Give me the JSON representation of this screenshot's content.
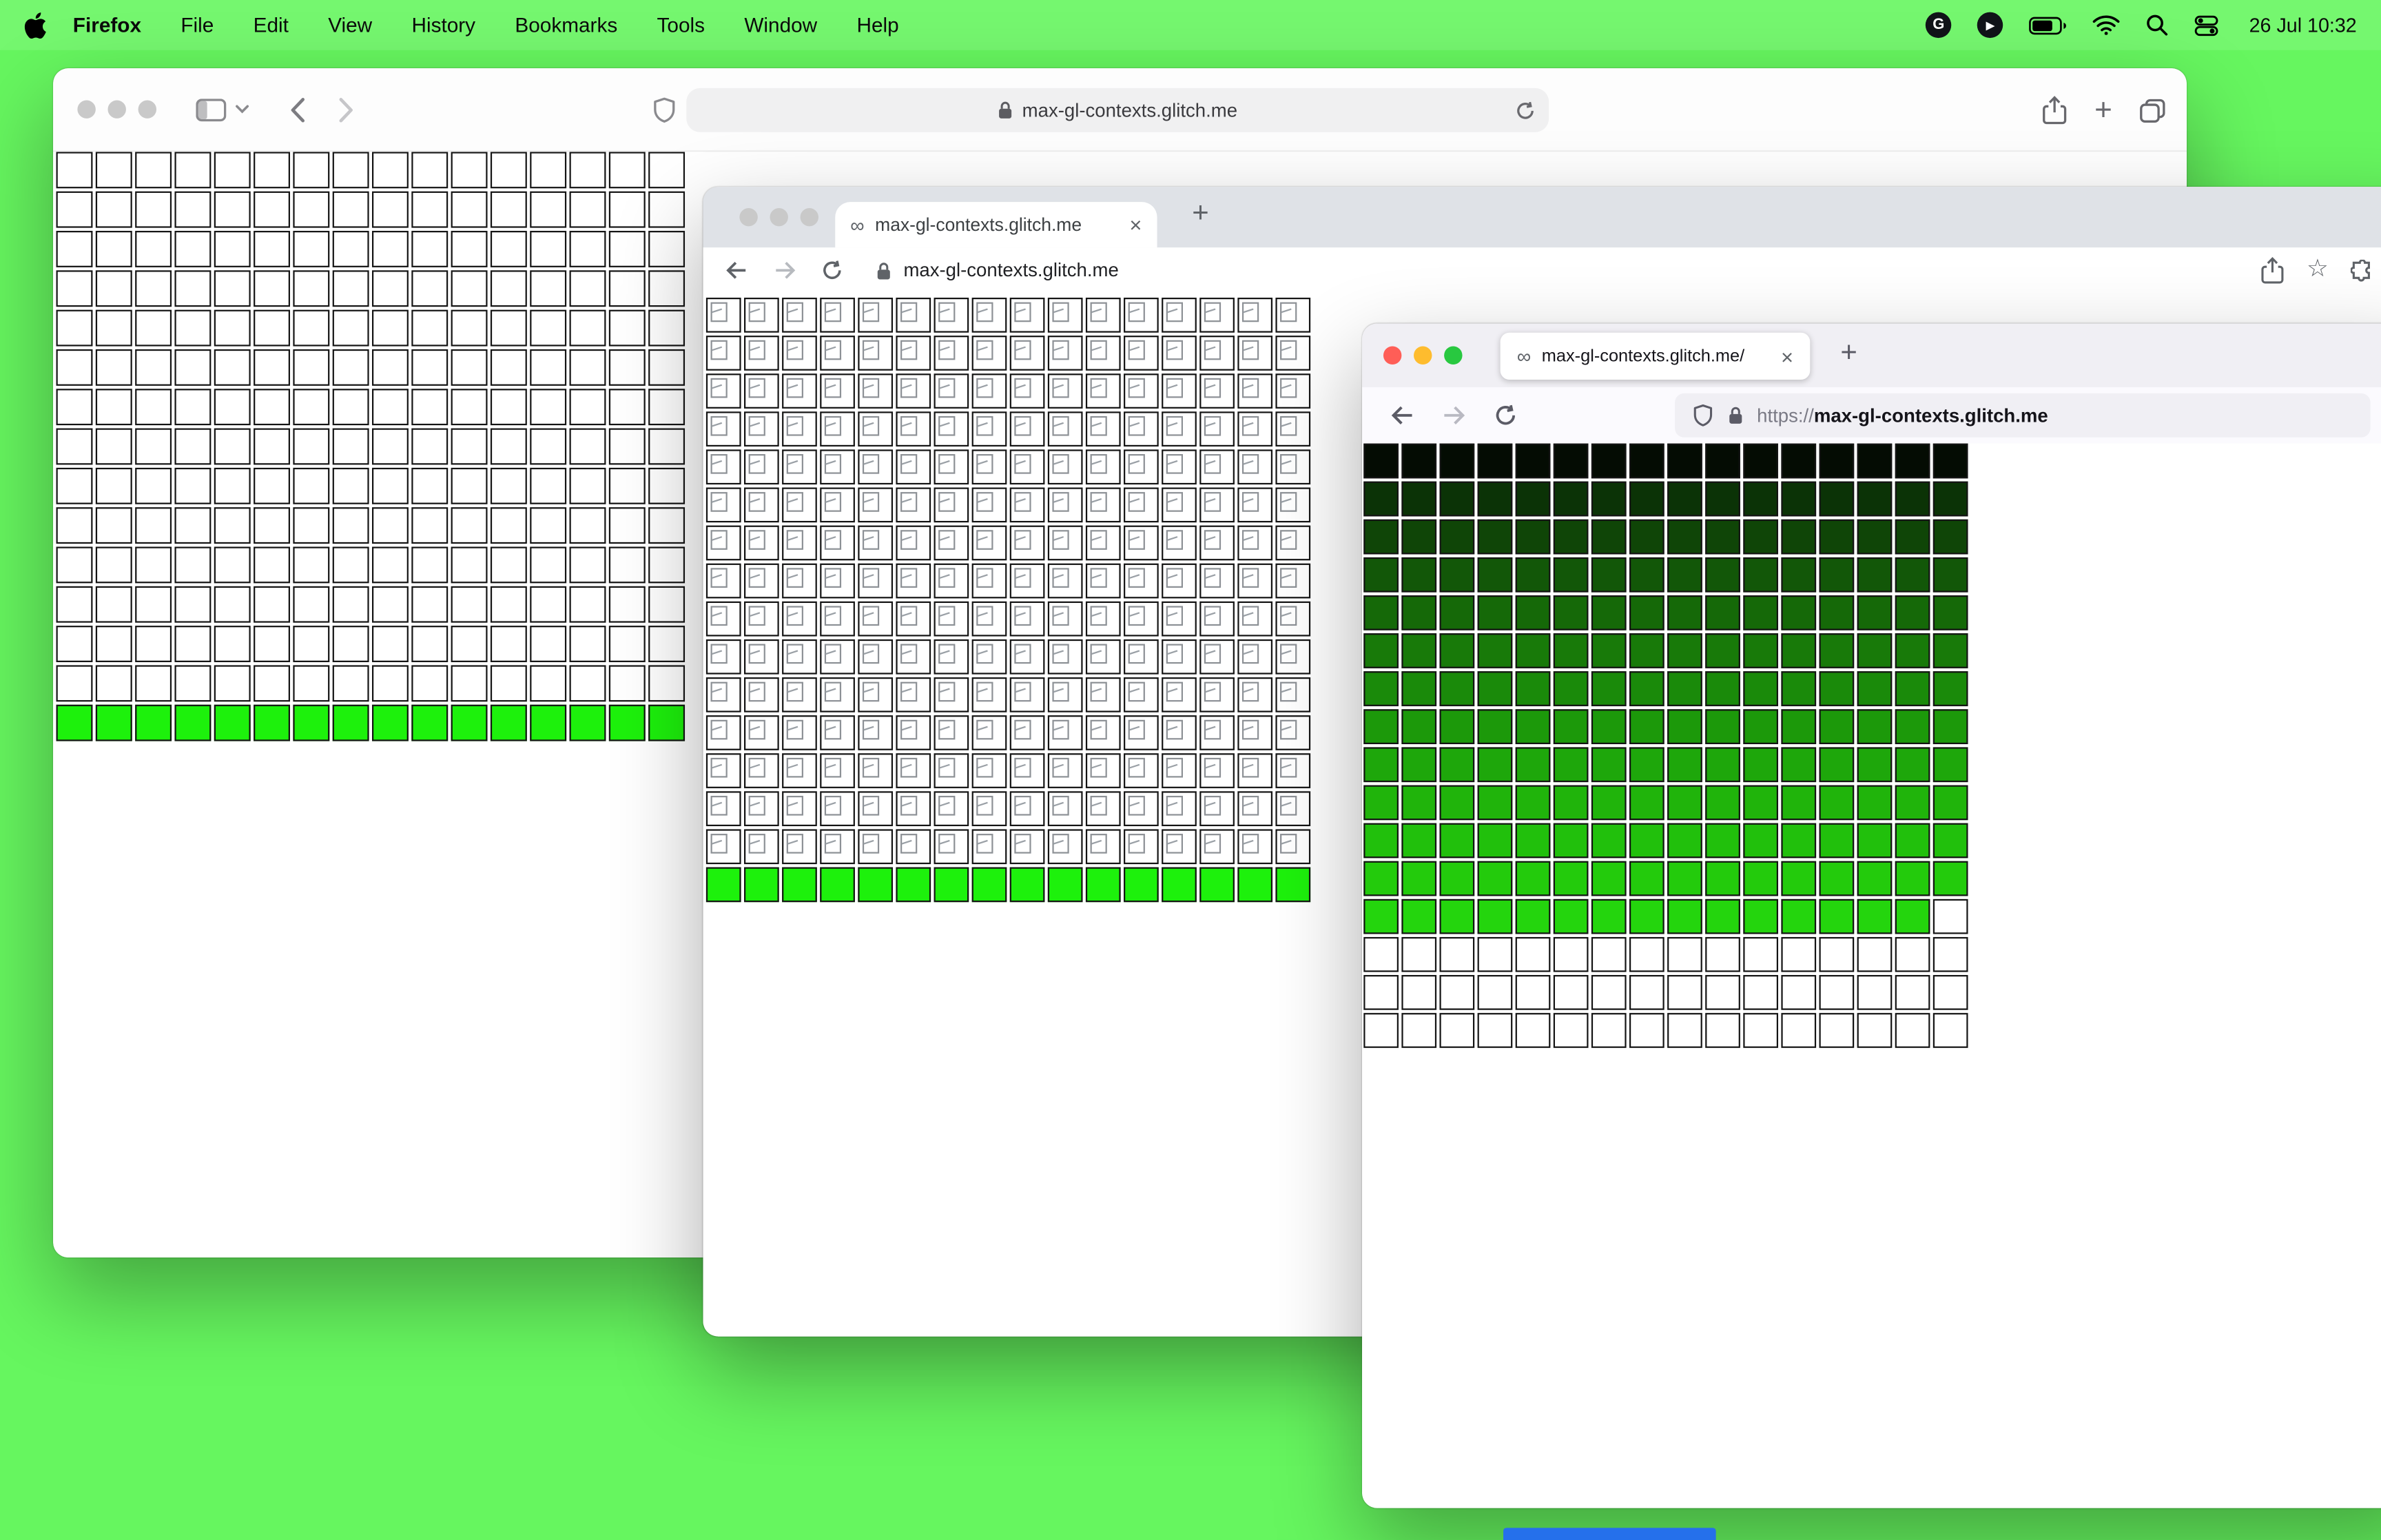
{
  "desktop": {
    "bg": "#66f65f",
    "dock_hint_color": "#2570eb"
  },
  "menu_bar": {
    "app_name": "Firefox",
    "menus": [
      "File",
      "Edit",
      "View",
      "History",
      "Bookmarks",
      "Tools",
      "Window",
      "Help"
    ],
    "status_icons": [
      "grammarly-icon",
      "play-icon",
      "battery-icon",
      "wifi-icon",
      "spotlight-icon",
      "control-center-icon"
    ],
    "clock": "26 Jul 10:32"
  },
  "safari_window": {
    "url": "max-gl-contexts.glitch.me",
    "grid": {
      "type": "plain",
      "cols": 16,
      "rows": 15,
      "green_last_row": true,
      "green": "#1df10c"
    }
  },
  "chrome_window": {
    "tab_title": "max-gl-contexts.glitch.me",
    "url": "max-gl-contexts.glitch.me",
    "grid": {
      "type": "broken",
      "cols": 16,
      "rows": 16,
      "green_last_row": true,
      "green": "#1df10c"
    }
  },
  "firefox_window": {
    "tab_title": "max-gl-contexts.glitch.me/",
    "url_scheme": "https://",
    "url_host": "max-gl-contexts.glitch.me",
    "grid": {
      "type": "gradient",
      "cols": 16,
      "rows": 16,
      "row_colors": [
        "#040c03",
        "#0b3306",
        "#0f4507",
        "#125708",
        "#156908",
        "#187a09",
        "#1a8a0a",
        "#1c990a",
        "#1ea70b",
        "#20b40b",
        "#21c00c",
        "#23cb0c"
      ],
      "partial_row_color": "#24d50d",
      "partial_row_missing_last": true,
      "trailing_white_rows": 3
    }
  }
}
